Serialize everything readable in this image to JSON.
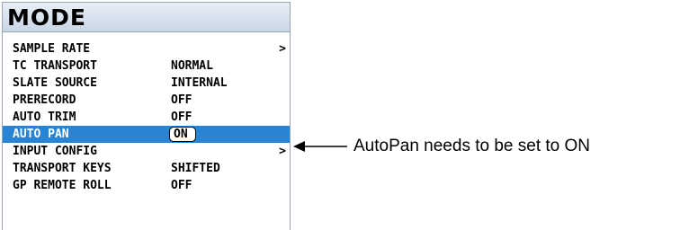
{
  "menu": {
    "title": "MODE",
    "items": [
      {
        "label": "SAMPLE RATE",
        "value": "",
        "submenu": ">"
      },
      {
        "label": "TC TRANSPORT",
        "value": "NORMAL",
        "submenu": ""
      },
      {
        "label": "SLATE SOURCE",
        "value": "INTERNAL",
        "submenu": ""
      },
      {
        "label": "PRERECORD",
        "value": "OFF",
        "submenu": ""
      },
      {
        "label": "AUTO TRIM",
        "value": "OFF",
        "submenu": ""
      },
      {
        "label": "AUTO PAN",
        "value": "ON",
        "submenu": "",
        "selected": true
      },
      {
        "label": "INPUT CONFIG",
        "value": "",
        "submenu": ">"
      },
      {
        "label": "TRANSPORT KEYS",
        "value": "SHIFTED",
        "submenu": ""
      },
      {
        "label": "GP REMOTE ROLL",
        "value": "OFF",
        "submenu": ""
      }
    ]
  },
  "annotation": {
    "text": "AutoPan needs to be set to ON",
    "arrow_icon": "left-arrow-icon"
  },
  "colors": {
    "highlight": "#2a84d5",
    "title_bar": "#c9d6e5",
    "border": "#9aa6b4"
  }
}
